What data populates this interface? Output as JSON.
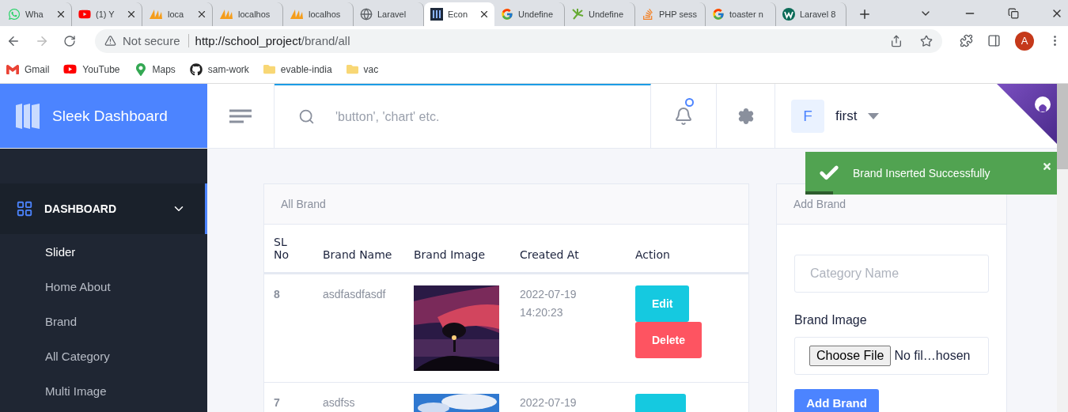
{
  "browser": {
    "tabs": [
      {
        "title": "Wha",
        "closable": true,
        "selected": false
      },
      {
        "title": "(1) Y",
        "closable": true,
        "selected": false
      },
      {
        "title": "loca",
        "closable": true,
        "selected": false
      },
      {
        "title": "localhos",
        "closable": false,
        "selected": false
      },
      {
        "title": "localhos",
        "closable": false,
        "selected": false
      },
      {
        "title": "Laravel",
        "closable": false,
        "selected": false
      },
      {
        "title": "Econ",
        "closable": true,
        "selected": true
      },
      {
        "title": "Undefine",
        "closable": false,
        "selected": false
      },
      {
        "title": "Undefine",
        "closable": false,
        "selected": false
      },
      {
        "title": "PHP sess",
        "closable": false,
        "selected": false
      },
      {
        "title": "toaster n",
        "closable": false,
        "selected": false
      },
      {
        "title": "Laravel 8",
        "closable": false,
        "selected": false
      }
    ],
    "security": "Not secure",
    "url_host": "http://school_project",
    "url_path": "/brand/all",
    "profile": "A",
    "bookmarks": [
      {
        "label": "Gmail"
      },
      {
        "label": "YouTube"
      },
      {
        "label": "Maps"
      },
      {
        "label": "sam-work"
      },
      {
        "label": "evable-india"
      },
      {
        "label": "vac"
      }
    ]
  },
  "app": {
    "brand": "Sleek Dashboard",
    "search_placeholder": "'button', 'chart' etc.",
    "notification_dot": true,
    "user": {
      "initial": "F",
      "name": "first"
    },
    "sidebar": [
      {
        "label": "DASHBOARD",
        "expanded": true,
        "children": [
          {
            "label": "Slider"
          },
          {
            "label": "Home About"
          },
          {
            "label": "Brand"
          },
          {
            "label": "All Category"
          },
          {
            "label": "Multi Image"
          }
        ]
      }
    ],
    "toast": {
      "message": "Brand Inserted Successfully"
    },
    "table": {
      "title": "All Brand",
      "columns": [
        "SL No",
        "Brand Name",
        "Brand Image",
        "Created At",
        "Action"
      ],
      "rows": [
        {
          "sl": "8",
          "name": "asdfasdfasdf",
          "created": [
            "2022-07-19",
            "14:20:23"
          ],
          "actions": [
            {
              "kind": "edit",
              "label": "Edit"
            },
            {
              "kind": "delete",
              "label": "Delete"
            }
          ]
        },
        {
          "sl": "7",
          "name": "asdfss",
          "created": [
            "2022-07-19"
          ],
          "actions": [
            {
              "kind": "edit"
            }
          ]
        }
      ]
    },
    "form": {
      "title": "Add Brand",
      "name_placeholder": "Category Name",
      "image_label": "Brand Image",
      "file_button": "Choose File",
      "file_status": "No fil…hosen",
      "submit": "Add Brand"
    }
  }
}
